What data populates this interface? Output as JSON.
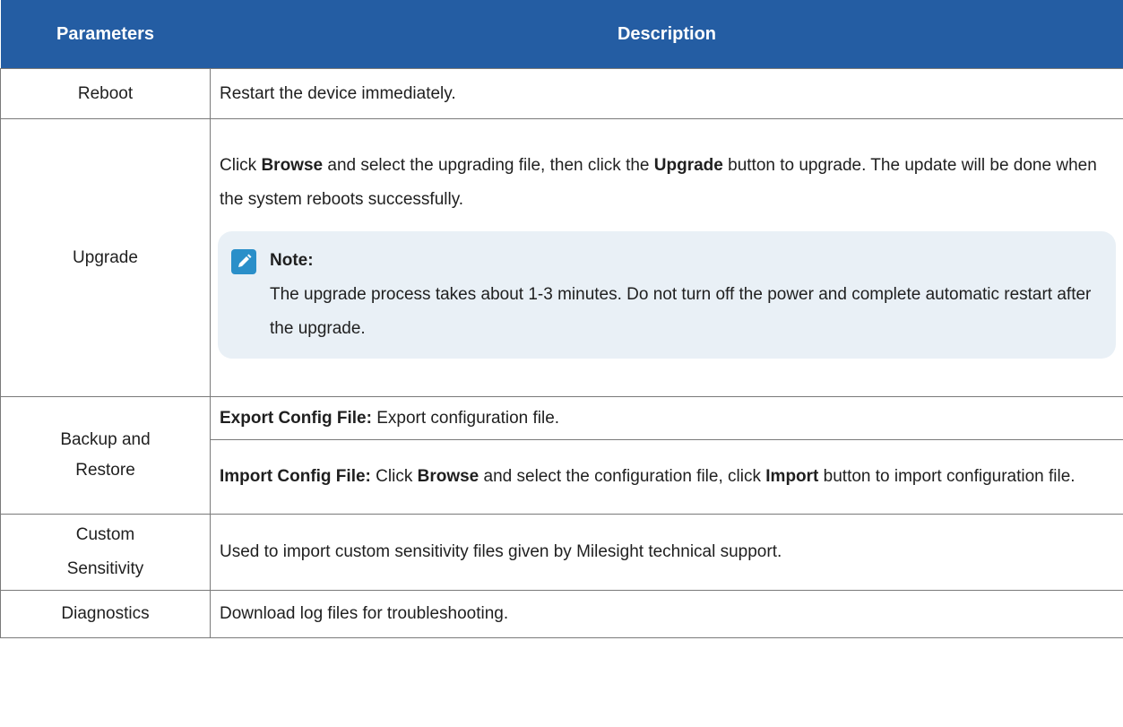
{
  "table": {
    "headers": {
      "parameters": "Parameters",
      "description": "Description"
    },
    "reboot": {
      "param": "Reboot",
      "desc": "Restart the device immediately."
    },
    "upgrade": {
      "param": "Upgrade",
      "line1_a": "Click ",
      "line1_b": "Browse",
      "line1_c": " and select the upgrading file, then click the ",
      "line1_d": "Upgrade",
      "line1_e": " button to upgrade. The update will be done when the system reboots successfully.",
      "note_title": "Note:",
      "note_text": "The upgrade process takes about 1-3 minutes. Do not turn off the power and complete automatic restart after the upgrade."
    },
    "backup": {
      "param": "Backup and Restore",
      "export_label": "Export Config File:",
      "export_text": " Export configuration file.",
      "import_label": "Import Config File:",
      "import_a": " Click ",
      "import_b": "Browse",
      "import_c": " and select the configuration file, click ",
      "import_d": "Import",
      "import_e": " button to import configuration file."
    },
    "custom": {
      "param": "Custom Sensitivity",
      "desc": "Used to import custom sensitivity files given by Milesight technical support."
    },
    "diagnostics": {
      "param": "Diagnostics",
      "desc": "Download log files for troubleshooting."
    }
  },
  "colors": {
    "header_bg": "#245da3",
    "note_bg": "#e9f0f6",
    "note_icon": "#2a8fc9"
  },
  "icons": {
    "note": "pencil-icon"
  }
}
